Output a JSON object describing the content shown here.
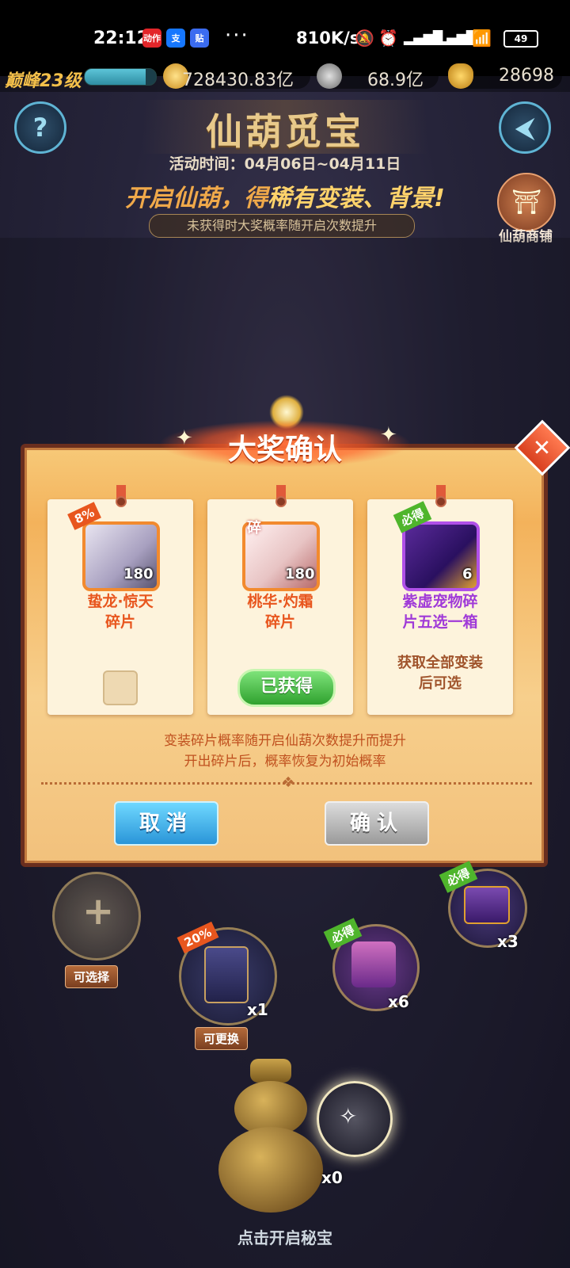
{
  "status_bar": {
    "time": "22:12",
    "app_icons": [
      "动作",
      "支",
      "贴"
    ],
    "more": "···",
    "net_speed": "810K/s",
    "battery": "49"
  },
  "resources": {
    "level": "巅峰23级",
    "level_progress": 0.85,
    "gold": "728430.83亿",
    "coins": "68.9亿",
    "ingots": "28698"
  },
  "header": {
    "title": "仙葫觅宝",
    "event_time": "活动时间：04月06日~04月11日",
    "promo_prefix": "开启仙葫，得",
    "promo_highlight": "稀有变装、背景!",
    "sub_banner": "未获得时大奖概率随开启次数提升",
    "shop_label": "仙葫商铺"
  },
  "modal": {
    "title": "大奖确认",
    "cards": [
      {
        "tag": "8%",
        "count": "180",
        "name_line1": "蛰龙·惊天",
        "name_line2": "碎片"
      },
      {
        "tag": "碎",
        "count": "180",
        "name_line1": "桃华·灼霜",
        "name_line2": "碎片",
        "status": "已获得"
      },
      {
        "tag": "必得",
        "count": "6",
        "name_line1": "紫虚宠物碎",
        "name_line2": "片五选一箱",
        "note_line1": "获取全部变装",
        "note_line2": "后可选"
      }
    ],
    "prob_note_line1": "变装碎片概率随开启仙葫次数提升而提升",
    "prob_note_line2": "开出碎片后，概率恢复为初始概率",
    "cancel": "取消",
    "confirm": "确认"
  },
  "rewards": {
    "selectable_label": "可选择",
    "slot2_tag": "20%",
    "slot2_count": "x1",
    "slot2_label": "可更换",
    "slot3_tag": "必得",
    "slot3_count": "x6",
    "slot4_tag": "必得",
    "slot4_count": "x3",
    "gourd_count": "x0",
    "open_hint": "点击开启秘宝"
  }
}
